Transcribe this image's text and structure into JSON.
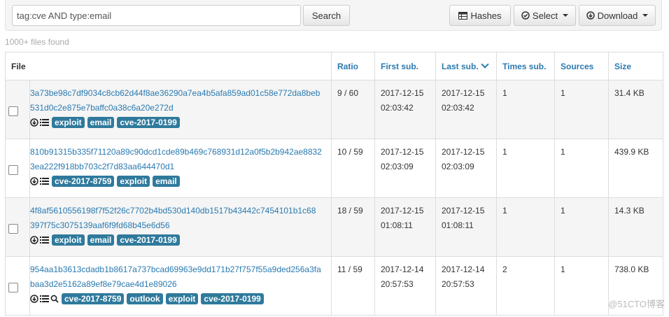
{
  "search": {
    "value": "tag:cve AND type:email",
    "button_label": "Search"
  },
  "toolbar": {
    "hashes_label": "Hashes",
    "select_label": "Select",
    "download_label": "Download"
  },
  "results_count": "1000+ files found",
  "columns": {
    "file": "File",
    "ratio": "Ratio",
    "first_sub": "First sub.",
    "last_sub": "Last sub.",
    "times_sub": "Times sub.",
    "sources": "Sources",
    "size": "Size"
  },
  "rows": [
    {
      "hash_1": "3a73be98c7df9034c8cb62d44f8ae36290a7ea4b5afa859ad01c58e772da8beb",
      "hash_2": "531d0c2e875e7baffc0a38c6a20e272d",
      "tags": [
        "exploit",
        "email",
        "cve-2017-0199"
      ],
      "ratio": "9 / 60",
      "first_date": "2017-12-15",
      "first_time": "02:03:42",
      "last_date": "2017-12-15",
      "last_time": "02:03:42",
      "times": "1",
      "sources": "1",
      "size": "31.4 KB"
    },
    {
      "hash_1": "810b91315b335f71120a89c90dcd1cde89b469c768931d12a0f5b2b942ae8832",
      "hash_2": "3ea222f918bb703c2f7d83aa644470d1",
      "tags": [
        "cve-2017-8759",
        "exploit",
        "email"
      ],
      "ratio": "10 / 59",
      "first_date": "2017-12-15",
      "first_time": "02:03:09",
      "last_date": "2017-12-15",
      "last_time": "02:03:09",
      "times": "1",
      "sources": "1",
      "size": "439.9 KB"
    },
    {
      "hash_1": "4f8af5610556198f7f52f26c7702b4bd530d140db1517b43442c7454101b1c68",
      "hash_2": "397f75c3075139aaf6f9fd68b45e6d56",
      "tags": [
        "exploit",
        "email",
        "cve-2017-0199"
      ],
      "ratio": "18 / 59",
      "first_date": "2017-12-15",
      "first_time": "01:08:11",
      "last_date": "2017-12-15",
      "last_time": "01:08:11",
      "times": "1",
      "sources": "1",
      "size": "14.3 KB"
    },
    {
      "hash_1": "954aa1b3613cdadb1b8617a737bcad69963e9dd171b27f757f55a9ded256a3fa",
      "hash_2": "baa3d2e5162a89ef8e79cae4d1e89026",
      "tags": [
        "cve-2017-8759",
        "outlook",
        "exploit",
        "cve-2017-0199"
      ],
      "ratio": "11 / 59",
      "first_date": "2017-12-14",
      "first_time": "20:57:53",
      "last_date": "2017-12-14",
      "last_time": "20:57:53",
      "times": "2",
      "sources": "1",
      "size": "738.0 KB"
    }
  ],
  "watermark": "@51CTO博客",
  "icons": {
    "download": "download-icon",
    "list": "list-icon",
    "search": "search-icon",
    "hashes": "table-icon",
    "select": "check-circle-icon"
  }
}
